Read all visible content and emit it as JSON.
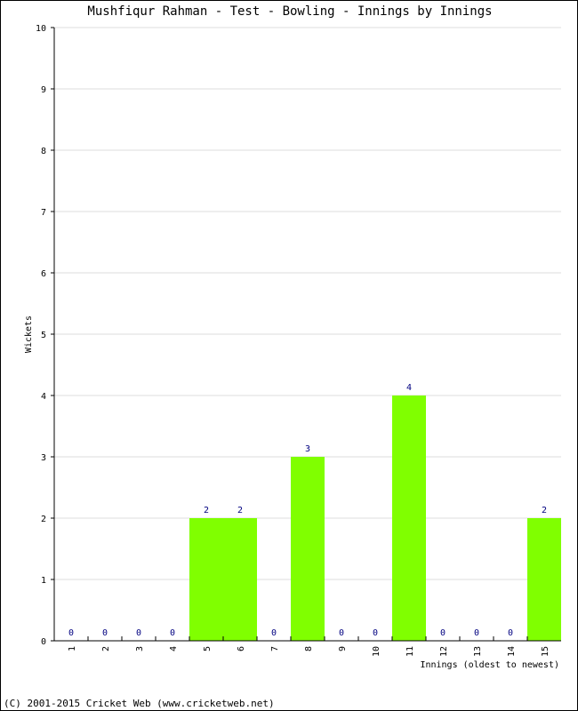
{
  "chart_data": {
    "type": "bar",
    "title": "Mushfiqur Rahman - Test - Bowling - Innings by Innings",
    "xlabel": "Innings (oldest to newest)",
    "ylabel": "Wickets",
    "categories": [
      "1",
      "2",
      "3",
      "4",
      "5",
      "6",
      "7",
      "8",
      "9",
      "10",
      "11",
      "12",
      "13",
      "14",
      "15"
    ],
    "values": [
      0,
      0,
      0,
      0,
      2,
      2,
      0,
      3,
      0,
      0,
      4,
      0,
      0,
      0,
      2
    ],
    "ylim": [
      0,
      10
    ],
    "yticks": [
      0,
      1,
      2,
      3,
      4,
      5,
      6,
      7,
      8,
      9,
      10
    ],
    "grid": true,
    "bar_color": "#80ff00",
    "label_color": "#000080",
    "grid_color": "#dddddd"
  },
  "footer": "(C) 2001-2015 Cricket Web (www.cricketweb.net)"
}
